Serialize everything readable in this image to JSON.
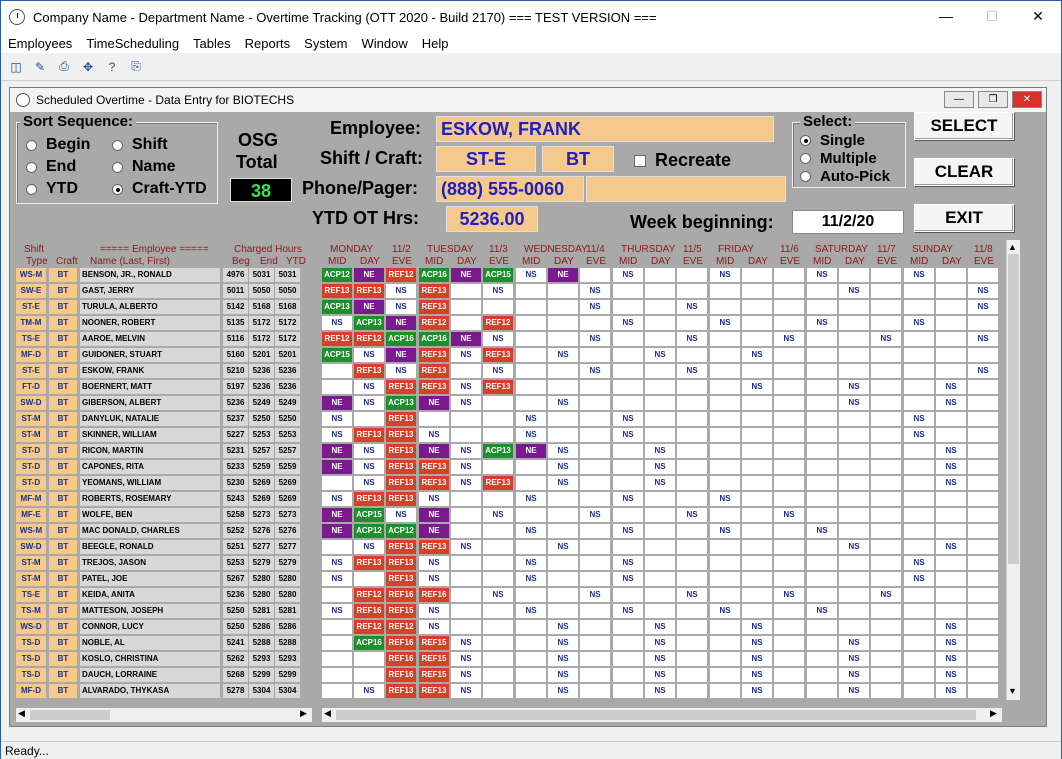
{
  "window": {
    "title": "Company Name - Department Name - Overtime Tracking (OTT 2020 - Build 2170)  === TEST VERSION ==="
  },
  "menu": [
    "Employees",
    "TimeScheduling",
    "Tables",
    "Reports",
    "System",
    "Window",
    "Help"
  ],
  "child": {
    "title": "Scheduled Overtime - Data Entry for BIOTECHS"
  },
  "sort": {
    "title": "Sort Sequence:",
    "options": [
      "Begin",
      "Shift",
      "End",
      "Name",
      "YTD",
      "Craft-YTD"
    ],
    "selected": "Craft-YTD"
  },
  "osg": {
    "label1": "OSG",
    "label2": "Total",
    "value": "38"
  },
  "employee": {
    "employee_label": "Employee:",
    "employee_value": "ESKOW, FRANK",
    "shift_label": "Shift / Craft:",
    "shift_value": "ST-E",
    "craft_value": "BT",
    "recreate_label": "Recreate",
    "phone_label": "Phone/Pager:",
    "phone_value": "(888) 555-0060",
    "ytd_label": "YTD OT Hrs:",
    "ytd_value": "5236.00",
    "week_label": "Week beginning:",
    "week_value": "11/2/20"
  },
  "select": {
    "title": "Select:",
    "options": [
      "Single",
      "Multiple",
      "Auto-Pick"
    ],
    "selected": "Single"
  },
  "buttons": {
    "select": "SELECT",
    "clear": "CLEAR",
    "exit": "EXIT"
  },
  "grid_headers": {
    "shift": "Shift",
    "type": "Type",
    "craft": "Craft",
    "employee": "===== Employee =====",
    "name": "Name (Last, First)",
    "charged": "Charged Hours",
    "beg": "Beg",
    "end": "End",
    "ytd": "YTD"
  },
  "days": [
    {
      "name": "MONDAY",
      "date": "11/2"
    },
    {
      "name": "TUESDAY",
      "date": "11/3"
    },
    {
      "name": "WEDNESDAY",
      "date": "11/4"
    },
    {
      "name": "THURSDAY",
      "date": "11/5"
    },
    {
      "name": "FRIDAY",
      "date": "11/6"
    },
    {
      "name": "SATURDAY",
      "date": "11/7"
    },
    {
      "name": "SUNDAY",
      "date": "11/8"
    }
  ],
  "shift_cols": [
    "MID",
    "DAY",
    "EVE"
  ],
  "employees": [
    {
      "shift": "WS-M",
      "craft": "BT",
      "name": "BENSON, JR., RONALD",
      "beg": "4976",
      "end": "5031",
      "ytd": "5031",
      "cells": [
        "ACP12",
        "NE",
        "REF12",
        "ACP16",
        "NE",
        "ACP15",
        "NS",
        "NE",
        "",
        "NS",
        "",
        "",
        "NS",
        "",
        "",
        "NS",
        "",
        "",
        "NS",
        "",
        ""
      ]
    },
    {
      "shift": "SW-E",
      "craft": "BT",
      "name": "GAST, JERRY",
      "beg": "5011",
      "end": "5050",
      "ytd": "5050",
      "cells": [
        "REF13",
        "REF13",
        "NS",
        "REF13",
        "",
        "NS",
        "",
        "",
        "NS",
        "",
        "",
        "",
        "",
        "",
        "",
        "",
        "NS",
        "",
        "",
        "",
        "NS"
      ]
    },
    {
      "shift": "ST-E",
      "craft": "BT",
      "name": "TURULA, ALBERTO",
      "beg": "5142",
      "end": "5168",
      "ytd": "5168",
      "cells": [
        "ACP13",
        "NE",
        "NS",
        "REF13",
        "",
        "",
        "",
        "",
        "NS",
        "",
        "",
        "NS",
        "",
        "",
        "",
        "",
        "",
        "",
        "",
        "",
        "NS"
      ]
    },
    {
      "shift": "TM-M",
      "craft": "BT",
      "name": "NOONER, ROBERT",
      "beg": "5135",
      "end": "5172",
      "ytd": "5172",
      "cells": [
        "NS",
        "ACP13",
        "NE",
        "REF12",
        "",
        "REF12",
        "",
        "",
        "",
        "NS",
        "",
        "",
        "NS",
        "",
        "",
        "NS",
        "",
        "",
        "NS",
        "",
        ""
      ]
    },
    {
      "shift": "TS-E",
      "craft": "BT",
      "name": "AAROE, MELVIN",
      "beg": "5116",
      "end": "5172",
      "ytd": "5172",
      "cells": [
        "REF12",
        "REF12",
        "ACP16",
        "ACP16",
        "NE",
        "NS",
        "",
        "",
        "NS",
        "",
        "",
        "NS",
        "",
        "",
        "NS",
        "",
        "",
        "NS",
        "",
        "",
        "NS"
      ]
    },
    {
      "shift": "MF-D",
      "craft": "BT",
      "name": "GUIDONER, STUART",
      "beg": "5160",
      "end": "5201",
      "ytd": "5201",
      "cells": [
        "ACP15",
        "NS",
        "NE",
        "REF13",
        "NS",
        "REF13",
        "",
        "NS",
        "",
        "",
        "NS",
        "",
        "",
        "NS",
        "",
        "",
        "",
        "",
        "",
        "",
        ""
      ]
    },
    {
      "shift": "ST-E",
      "craft": "BT",
      "name": "ESKOW, FRANK",
      "beg": "5210",
      "end": "5236",
      "ytd": "5236",
      "cells": [
        "",
        "REF13",
        "NS",
        "REF13",
        "",
        "NS",
        "",
        "",
        "NS",
        "",
        "",
        "NS",
        "",
        "",
        "",
        "",
        "",
        "",
        "",
        "",
        "NS"
      ]
    },
    {
      "shift": "FT-D",
      "craft": "BT",
      "name": "BOERNERT, MATT",
      "beg": "5197",
      "end": "5236",
      "ytd": "5236",
      "cells": [
        "",
        "NS",
        "REF13",
        "REF13",
        "NS",
        "REF13",
        "",
        "",
        "",
        "",
        "",
        "",
        "",
        "NS",
        "",
        "",
        "NS",
        "",
        "",
        "NS",
        ""
      ]
    },
    {
      "shift": "SW-D",
      "craft": "BT",
      "name": "GIBERSON, ALBERT",
      "beg": "5236",
      "end": "5249",
      "ytd": "5249",
      "cells": [
        "NE",
        "NS",
        "ACP13",
        "NE",
        "NS",
        "",
        "",
        "NS",
        "",
        "",
        "",
        "",
        "",
        "",
        "",
        "",
        "NS",
        "",
        "",
        "NS",
        ""
      ]
    },
    {
      "shift": "ST-M",
      "craft": "BT",
      "name": "DANYLUK, NATALIE",
      "beg": "5237",
      "end": "5250",
      "ytd": "5250",
      "cells": [
        "NS",
        "",
        "REF13",
        "",
        "",
        "",
        "NS",
        "",
        "",
        "NS",
        "",
        "",
        "",
        "",
        "",
        "",
        "",
        "",
        "NS",
        "",
        ""
      ]
    },
    {
      "shift": "ST-M",
      "craft": "BT",
      "name": "SKINNER, WILLIAM",
      "beg": "5227",
      "end": "5253",
      "ytd": "5253",
      "cells": [
        "NS",
        "REF13",
        "REF13",
        "NS",
        "",
        "",
        "NS",
        "",
        "",
        "NS",
        "",
        "",
        "",
        "",
        "",
        "",
        "",
        "",
        "NS",
        "",
        ""
      ]
    },
    {
      "shift": "ST-D",
      "craft": "BT",
      "name": "RICON, MARTIN",
      "beg": "5231",
      "end": "5257",
      "ytd": "5257",
      "cells": [
        "NE",
        "NS",
        "REF13",
        "NE",
        "NS",
        "ACP13",
        "NE",
        "NS",
        "",
        "",
        "NS",
        "",
        "",
        "",
        "",
        "",
        "",
        "",
        "",
        "NS",
        ""
      ]
    },
    {
      "shift": "ST-D",
      "craft": "BT",
      "name": "CAPONES, RITA",
      "beg": "5233",
      "end": "5259",
      "ytd": "5259",
      "cells": [
        "NE",
        "NS",
        "REF13",
        "REF13",
        "NS",
        "",
        "",
        "NS",
        "",
        "",
        "NS",
        "",
        "",
        "",
        "",
        "",
        "",
        "",
        "",
        "NS",
        ""
      ]
    },
    {
      "shift": "ST-D",
      "craft": "BT",
      "name": "YEOMANS, WILLIAM",
      "beg": "5230",
      "end": "5269",
      "ytd": "5269",
      "cells": [
        "",
        "NS",
        "REF13",
        "REF13",
        "NS",
        "REF13",
        "",
        "NS",
        "",
        "",
        "NS",
        "",
        "",
        "",
        "",
        "",
        "",
        "",
        "",
        "NS",
        ""
      ]
    },
    {
      "shift": "MF-M",
      "craft": "BT",
      "name": "ROBERTS, ROSEMARY",
      "beg": "5243",
      "end": "5269",
      "ytd": "5269",
      "cells": [
        "NS",
        "REF13",
        "REF13",
        "NS",
        "",
        "",
        "NS",
        "",
        "",
        "NS",
        "",
        "",
        "NS",
        "",
        "",
        "",
        "",
        "",
        "",
        "",
        ""
      ]
    },
    {
      "shift": "MF-E",
      "craft": "BT",
      "name": "WOLFE, BEN",
      "beg": "5258",
      "end": "5273",
      "ytd": "5273",
      "cells": [
        "NE",
        "ACP15",
        "NS",
        "NE",
        "",
        "NS",
        "",
        "",
        "NS",
        "",
        "",
        "NS",
        "",
        "",
        "NS",
        "",
        "",
        "",
        "",
        "",
        ""
      ]
    },
    {
      "shift": "WS-M",
      "craft": "BT",
      "name": "MAC DONALD, CHARLES",
      "beg": "5252",
      "end": "5276",
      "ytd": "5276",
      "cells": [
        "NE",
        "ACP12",
        "ACP12",
        "NE",
        "",
        "",
        "NS",
        "",
        "",
        "NS",
        "",
        "",
        "NS",
        "",
        "",
        "NS",
        "",
        "",
        "",
        "",
        ""
      ]
    },
    {
      "shift": "SW-D",
      "craft": "BT",
      "name": "BEEGLE, RONALD",
      "beg": "5251",
      "end": "5277",
      "ytd": "5277",
      "cells": [
        "",
        "NS",
        "REF13",
        "REF13",
        "NS",
        "",
        "",
        "NS",
        "",
        "",
        "",
        "",
        "",
        "",
        "",
        "",
        "NS",
        "",
        "",
        "NS",
        ""
      ]
    },
    {
      "shift": "ST-M",
      "craft": "BT",
      "name": "TREJOS, JASON",
      "beg": "5253",
      "end": "5279",
      "ytd": "5279",
      "cells": [
        "NS",
        "REF13",
        "REF13",
        "NS",
        "",
        "",
        "NS",
        "",
        "",
        "NS",
        "",
        "",
        "",
        "",
        "",
        "",
        "",
        "",
        "NS",
        "",
        ""
      ]
    },
    {
      "shift": "ST-M",
      "craft": "BT",
      "name": "PATEL, JOE",
      "beg": "5267",
      "end": "5280",
      "ytd": "5280",
      "cells": [
        "NS",
        "",
        "REF13",
        "NS",
        "",
        "",
        "NS",
        "",
        "",
        "NS",
        "",
        "",
        "",
        "",
        "",
        "",
        "",
        "",
        "NS",
        "",
        ""
      ]
    },
    {
      "shift": "TS-E",
      "craft": "BT",
      "name": "KEIDA, ANITA",
      "beg": "5236",
      "end": "5280",
      "ytd": "5280",
      "cells": [
        "",
        "REF12",
        "REF16",
        "REF16",
        "",
        "NS",
        "",
        "",
        "NS",
        "",
        "",
        "NS",
        "",
        "",
        "NS",
        "",
        "",
        "NS",
        "",
        "",
        ""
      ]
    },
    {
      "shift": "TS-M",
      "craft": "BT",
      "name": "MATTESON, JOSEPH",
      "beg": "5250",
      "end": "5281",
      "ytd": "5281",
      "cells": [
        "NS",
        "REF16",
        "REF15",
        "NS",
        "",
        "",
        "NS",
        "",
        "",
        "NS",
        "",
        "",
        "NS",
        "",
        "",
        "NS",
        "",
        "",
        "",
        "",
        ""
      ]
    },
    {
      "shift": "WS-D",
      "craft": "BT",
      "name": "CONNOR, LUCY",
      "beg": "5250",
      "end": "5286",
      "ytd": "5286",
      "cells": [
        "",
        "REF12",
        "REF12",
        "NS",
        "",
        "",
        "",
        "NS",
        "",
        "",
        "NS",
        "",
        "",
        "NS",
        "",
        "",
        "",
        "",
        "",
        "NS",
        ""
      ]
    },
    {
      "shift": "TS-D",
      "craft": "BT",
      "name": "NOBLE, AL",
      "beg": "5241",
      "end": "5288",
      "ytd": "5288",
      "cells": [
        "",
        "ACP16",
        "REF16",
        "REF15",
        "NS",
        "",
        "",
        "NS",
        "",
        "",
        "NS",
        "",
        "",
        "NS",
        "",
        "",
        "NS",
        "",
        "",
        "NS",
        ""
      ]
    },
    {
      "shift": "TS-D",
      "craft": "BT",
      "name": "KOSLO, CHRISTINA",
      "beg": "5262",
      "end": "5293",
      "ytd": "5293",
      "cells": [
        "",
        "",
        "REF16",
        "REF15",
        "NS",
        "",
        "",
        "NS",
        "",
        "",
        "NS",
        "",
        "",
        "NS",
        "",
        "",
        "NS",
        "",
        "",
        "NS",
        ""
      ]
    },
    {
      "shift": "TS-D",
      "craft": "BT",
      "name": "DAUCH, LORRAINE",
      "beg": "5268",
      "end": "5299",
      "ytd": "5299",
      "cells": [
        "",
        "",
        "REF16",
        "REF15",
        "NS",
        "",
        "",
        "NS",
        "",
        "",
        "NS",
        "",
        "",
        "NS",
        "",
        "",
        "NS",
        "",
        "",
        "NS",
        ""
      ]
    },
    {
      "shift": "MF-D",
      "craft": "BT",
      "name": "ALVARADO, THYKASA",
      "beg": "5278",
      "end": "5304",
      "ytd": "5304",
      "cells": [
        "",
        "NS",
        "REF13",
        "REF13",
        "NS",
        "",
        "",
        "NS",
        "",
        "",
        "NS",
        "",
        "",
        "NS",
        "",
        "",
        "NS",
        "",
        "",
        "NS",
        ""
      ]
    }
  ],
  "status": "Ready..."
}
